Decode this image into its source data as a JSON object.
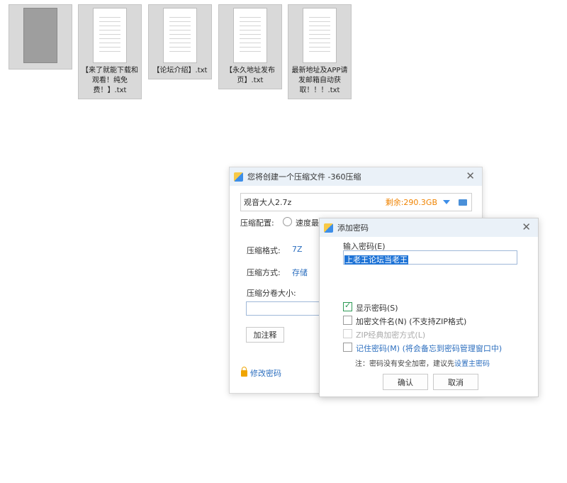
{
  "desktop": {
    "files": [
      {
        "label": "",
        "kind": "video",
        "thumbnail_visible": false
      },
      {
        "label": "【来了就能下载和观看！纯免费！】.txt",
        "kind": "text"
      },
      {
        "label": "【论坛介绍】.txt",
        "kind": "text"
      },
      {
        "label": "【永久地址发布页】.txt",
        "kind": "text"
      },
      {
        "label": "最新地址及APP请发邮箱自动获取！！！.txt",
        "kind": "text"
      }
    ]
  },
  "compress_window": {
    "title": "您将创建一个压缩文件 -360压缩",
    "archive_name": "观音大人2.7z",
    "remaining": "剩余:290.3GB",
    "config_label": "压缩配置:",
    "option_fast": "速度最",
    "format_label": "压缩格式:",
    "format_value": "7Z",
    "method_label": "压缩方式:",
    "method_value": "存储",
    "volume_label": "压缩分卷大小:",
    "comment_button": "加注释",
    "change_password": "修改密码"
  },
  "password_dialog": {
    "title": "添加密码",
    "input_label": "输入密码(E)",
    "password_value": "上老王论坛当老王",
    "show_password": "显示密码(S)",
    "encrypt_names": "加密文件名(N) (不支持ZIP格式)",
    "zip_classic": "ZIP经典加密方式(L)",
    "remember": "记住密码(M) (将会备忘到密码管理窗口中)",
    "note_prefix": "注：密码没有安全加密，建议先",
    "note_link": "设置主密码",
    "ok_button": "确认",
    "cancel_button": "取消"
  },
  "colors": {
    "accent": "#2d6fbf",
    "remaining": "#f08300",
    "titlebar": "#eaf1f8",
    "selection": "#1e73d6"
  }
}
